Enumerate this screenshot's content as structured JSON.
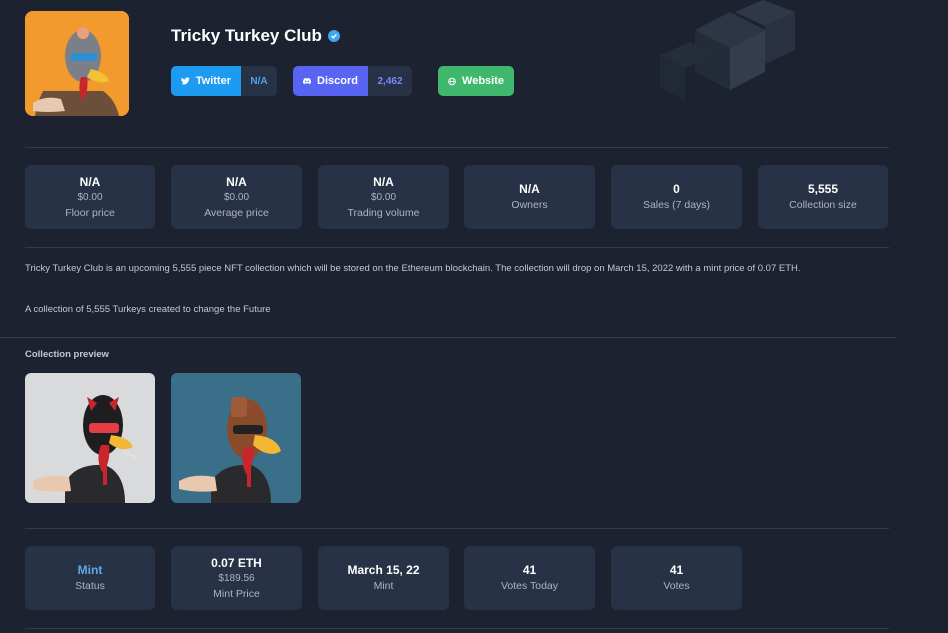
{
  "collection": {
    "name": "Tricky Turkey Club",
    "verified": true
  },
  "socials": {
    "twitter": {
      "label": "Twitter",
      "count": "N/A",
      "color": "#1d9bf0"
    },
    "discord": {
      "label": "Discord",
      "count": "2,462",
      "color": "#5865f2"
    },
    "website": {
      "label": "Website",
      "color": "#3fb86e"
    }
  },
  "stats": [
    {
      "value": "N/A",
      "sub": "$0.00",
      "label": "Floor price"
    },
    {
      "value": "N/A",
      "sub": "$0.00",
      "label": "Average price"
    },
    {
      "value": "N/A",
      "sub": "$0.00",
      "label": "Trading volume"
    },
    {
      "value": "N/A",
      "label": "Owners"
    },
    {
      "value": "0",
      "label": "Sales (7 days)"
    },
    {
      "value": "5,555",
      "label": "Collection size"
    }
  ],
  "description": {
    "paragraph1": "Tricky Turkey Club is an upcoming 5,555 piece NFT collection which will be stored on the Ethereum blockchain. The collection will drop on March 15, 2022 with a mint price of 0.07 ETH.",
    "paragraph2": "A collection of 5,555 Turkeys created to change the Future"
  },
  "preview": {
    "title": "Collection preview"
  },
  "mint_info": [
    {
      "value": "Mint",
      "label": "Status"
    },
    {
      "value": "0.07 ETH",
      "sub": "$189.56",
      "label": "Mint Price"
    },
    {
      "value": "March 15, 22",
      "label": "Mint"
    },
    {
      "value": "41",
      "label": "Votes Today"
    },
    {
      "value": "41",
      "label": "Votes"
    }
  ],
  "colors": {
    "background": "#1c2230",
    "card": "#273246",
    "status_accent": "#5ea9e6"
  }
}
